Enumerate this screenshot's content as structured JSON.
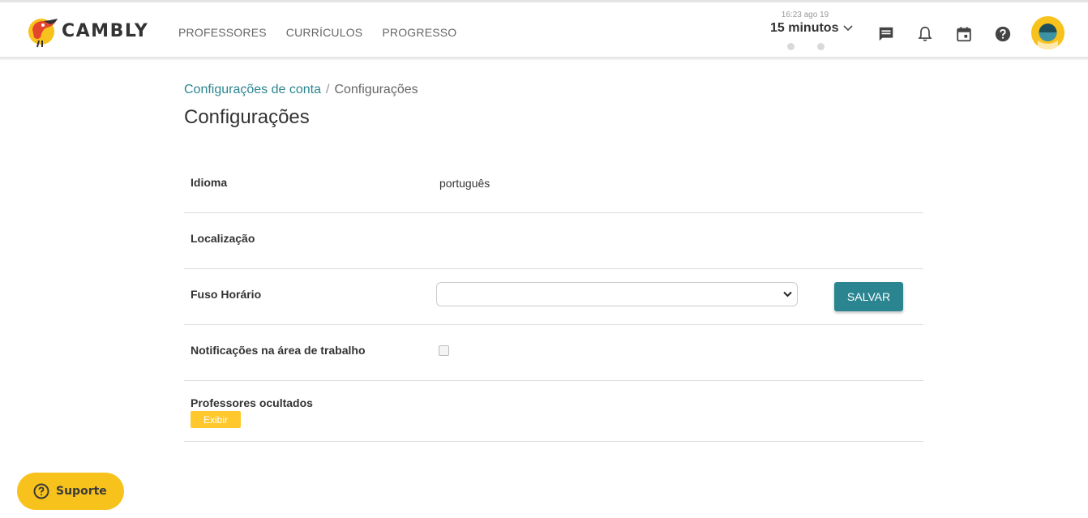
{
  "brand": {
    "name": "CAMBLY",
    "accent": "#2b8590",
    "yellow": "#f7c21b"
  },
  "nav": {
    "items": [
      {
        "label": "PROFESSORES"
      },
      {
        "label": "CURRÍCULOS"
      },
      {
        "label": "PROGRESSO"
      }
    ]
  },
  "minutes": {
    "date": "16:23 ago 19",
    "value": "15 minutos"
  },
  "header_icons": [
    "chat-icon",
    "bell-icon",
    "calendar-icon",
    "help-icon"
  ],
  "breadcrumb": {
    "parent": "Configurações de conta",
    "separator": "/",
    "current": "Configurações"
  },
  "page_title": "Configurações",
  "settings": {
    "language": {
      "label": "Idioma",
      "value": "português"
    },
    "location": {
      "label": "Localização"
    },
    "timezone": {
      "label": "Fuso Horário",
      "selected": "",
      "save_label": "SALVAR"
    },
    "notifications": {
      "label": "Notificações na área de trabalho",
      "checked": false
    },
    "hidden_teachers": {
      "label": "Professores ocultados",
      "show_label": "Exibir"
    }
  },
  "support": {
    "label": "Suporte"
  }
}
